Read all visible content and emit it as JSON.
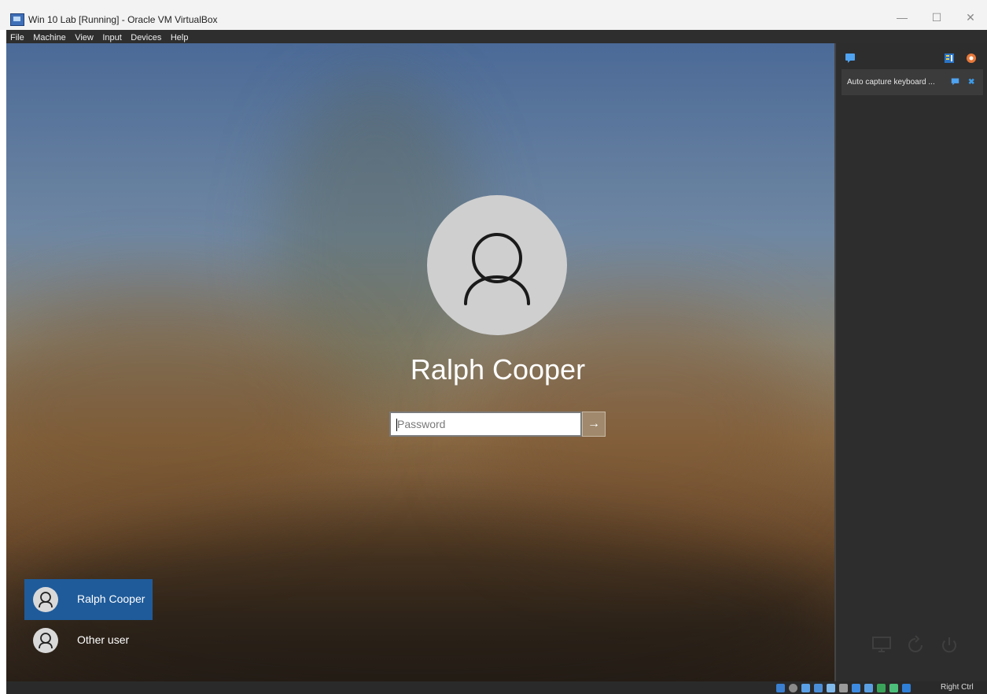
{
  "window": {
    "title": "Win 10 Lab [Running] - Oracle VM VirtualBox",
    "controls": {
      "minimize": "—",
      "maximize": "☐",
      "close": "✕"
    }
  },
  "menu": [
    "File",
    "Machine",
    "View",
    "Input",
    "Devices",
    "Help"
  ],
  "lockscreen": {
    "user_name": "Ralph Cooper",
    "password_placeholder": "Password",
    "password_value": "",
    "submit_glyph": "→",
    "users": [
      {
        "name": "Ralph Cooper",
        "selected": true
      },
      {
        "name": "Other user",
        "selected": false
      }
    ]
  },
  "sidebar": {
    "notification_text": "Auto capture keyboard ...",
    "icons": [
      "chat-icon",
      "sort-icon",
      "settings-gear-icon",
      "message-icon",
      "close-icon",
      "display-icon",
      "reset-icon",
      "power-icon"
    ]
  },
  "statusbar": {
    "host_key": "Right Ctrl",
    "icons": [
      "hard-disk-icon",
      "optical-drive-icon",
      "audio-icon",
      "network-icon",
      "usb-icon",
      "shared-folder-icon",
      "display-icon",
      "recording-icon",
      "cpu-icon",
      "mouse-integration-icon",
      "keyboard-icon"
    ]
  },
  "colors": {
    "accent": "#1f5b9a",
    "submit": "#a0896c",
    "sidebar_bg": "#2d2d2e",
    "notice_button": "#3d9be8"
  }
}
